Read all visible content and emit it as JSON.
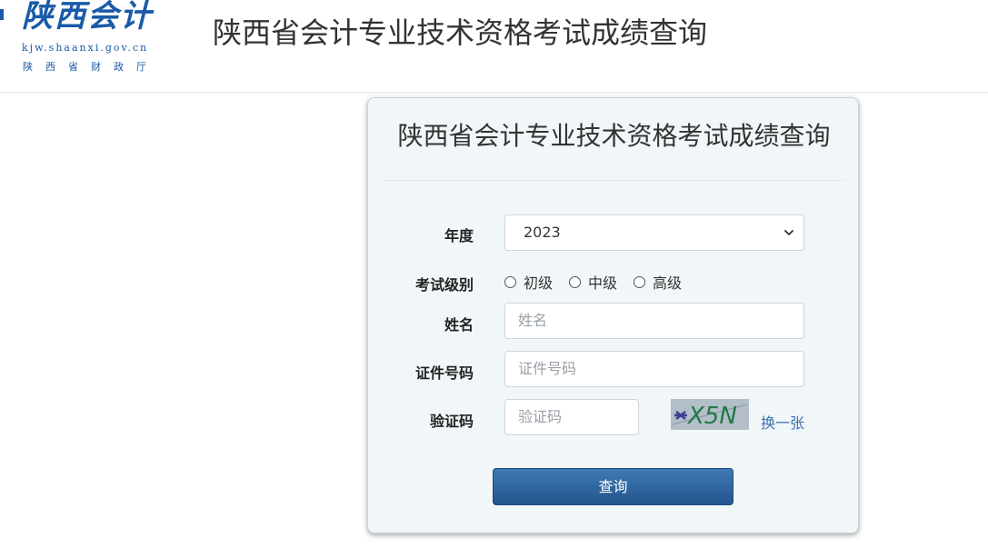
{
  "logo": {
    "cn": "陕西会计",
    "url": "kjw.shaanxi.gov.cn",
    "dept": "陕西省财政厅"
  },
  "header": {
    "title": "陕西省会计专业技术资格考试成绩查询"
  },
  "form": {
    "title": "陕西省会计专业技术资格考试成绩查询",
    "year_label": "年度",
    "year_value": "2023",
    "level_label": "考试级别",
    "levels": [
      "初级",
      "中级",
      "高级"
    ],
    "name_label": "姓名",
    "name_placeholder": "姓名",
    "id_label": "证件号码",
    "id_placeholder": "证件号码",
    "captcha_label": "验证码",
    "captcha_placeholder": "验证码",
    "captcha_text": "X5N",
    "refresh_label": "换一张",
    "submit_label": "查询"
  },
  "colors": {
    "brand": "#1a5aa8",
    "button": "#2f6aa3",
    "card_bg": "#f1f7f9"
  }
}
